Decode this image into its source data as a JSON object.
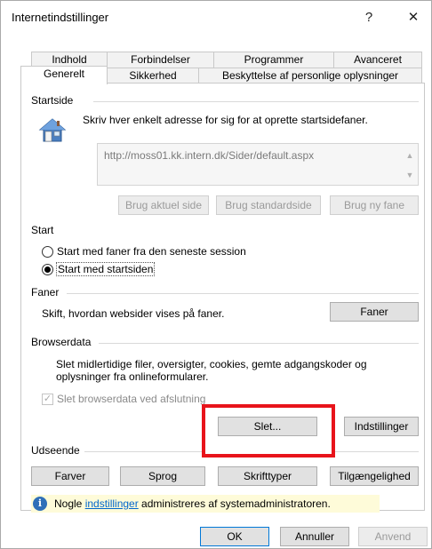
{
  "window": {
    "title": "Internetindstillinger",
    "help_glyph": "?",
    "close_glyph": "✕"
  },
  "tabs": {
    "row1": [
      "Indhold",
      "Forbindelser",
      "Programmer",
      "Avanceret"
    ],
    "row2": [
      "Generelt",
      "Sikkerhed",
      "Beskyttelse af personlige oplysninger"
    ],
    "active": "Generelt"
  },
  "startside": {
    "label": "Startside",
    "instruction": "Skriv hver enkelt adresse for sig for at oprette startsidefaner.",
    "url": "http://moss01.kk.intern.dk/Sider/default.aspx",
    "buttons": {
      "current": "Brug aktuel side",
      "default": "Brug standardside",
      "new_tab": "Brug ny fane"
    }
  },
  "start": {
    "label": "Start",
    "option_last_session": "Start med faner fra den seneste session",
    "option_startpage": "Start med startsiden",
    "selected": "option_startpage"
  },
  "faner": {
    "label": "Faner",
    "description": "Skift, hvordan websider vises på faner.",
    "button": "Faner"
  },
  "browserdata": {
    "label": "Browserdata",
    "description_line1": "Slet midlertidige filer, oversigter, cookies, gemte adgangskoder og",
    "description_line2": "oplysninger fra onlineformularer.",
    "checkbox_label": "Slet browserdata ved afslutning",
    "checkbox_checked": true,
    "delete_button": "Slet...",
    "settings_button": "Indstillinger"
  },
  "udseende": {
    "label": "Udseende",
    "buttons": [
      "Farver",
      "Sprog",
      "Skrifttyper",
      "Tilgængelighed"
    ]
  },
  "info": {
    "prefix": "Nogle ",
    "link": "indstillinger",
    "suffix": " administreres af systemadministratoren."
  },
  "footer": {
    "ok": "OK",
    "cancel": "Annuller",
    "apply": "Anvend"
  },
  "colors": {
    "highlight": "#e8141b",
    "link": "#0066cc",
    "info_bar": "#fefbd9"
  }
}
